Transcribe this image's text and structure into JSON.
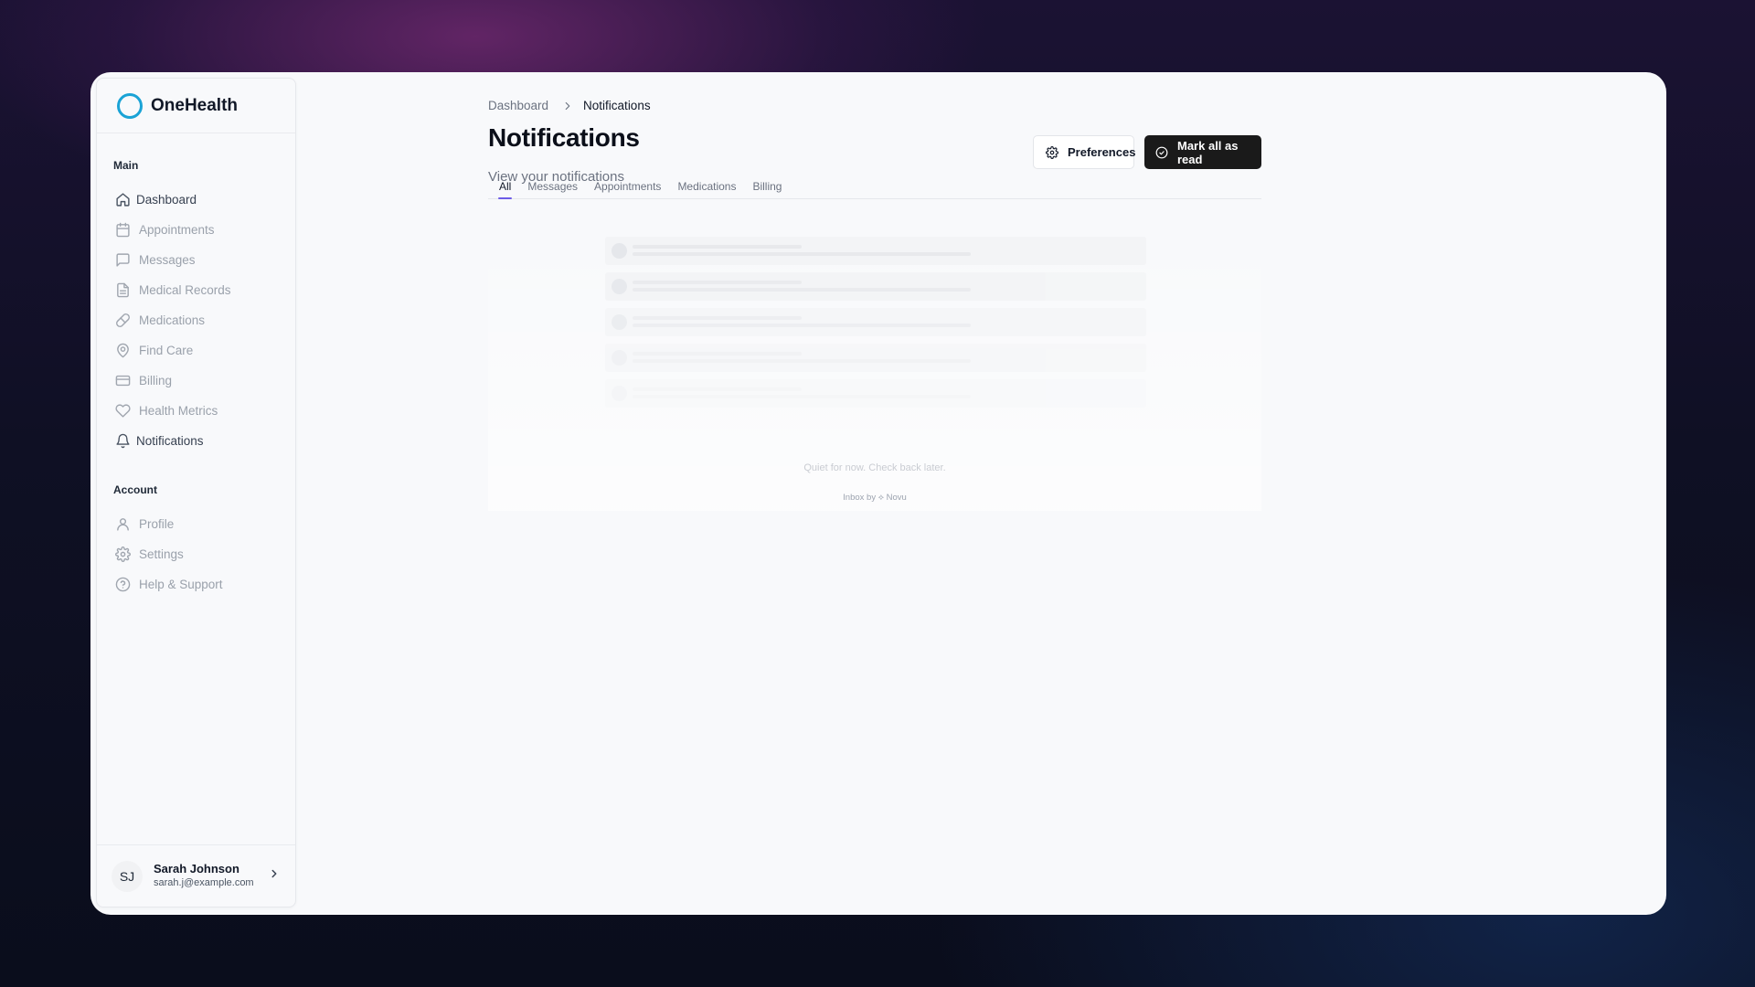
{
  "app": {
    "name": "OneHealth",
    "brand_color": "#1aa3d6"
  },
  "sidebar": {
    "main_title": "Main",
    "main_items": [
      {
        "label": "Dashboard",
        "icon": "home-icon"
      },
      {
        "label": "Appointments",
        "icon": "calendar-icon"
      },
      {
        "label": "Messages",
        "icon": "message-icon"
      },
      {
        "label": "Medical Records",
        "icon": "document-icon"
      },
      {
        "label": "Medications",
        "icon": "pill-icon"
      },
      {
        "label": "Find Care",
        "icon": "map-pin-icon"
      },
      {
        "label": "Billing",
        "icon": "credit-card-icon"
      },
      {
        "label": "Health Metrics",
        "icon": "heart-icon"
      },
      {
        "label": "Notifications",
        "icon": "bell-icon"
      }
    ],
    "account_title": "Account",
    "account_items": [
      {
        "label": "Profile",
        "icon": "user-icon"
      },
      {
        "label": "Settings",
        "icon": "gear-icon"
      },
      {
        "label": "Help & Support",
        "icon": "help-circle-icon"
      }
    ],
    "user": {
      "initials": "SJ",
      "name": "Sarah Johnson",
      "email": "sarah.j@example.com"
    }
  },
  "breadcrumb": {
    "parent": "Dashboard",
    "current": "Notifications"
  },
  "header": {
    "title": "Notifications",
    "subtitle": "View your notifications",
    "preferences_label": "Preferences",
    "mark_all_label": "Mark all as read"
  },
  "tabs": [
    {
      "label": "All",
      "active": true
    },
    {
      "label": "Messages",
      "active": false
    },
    {
      "label": "Appointments",
      "active": false
    },
    {
      "label": "Medications",
      "active": false
    },
    {
      "label": "Billing",
      "active": false
    }
  ],
  "inbox": {
    "empty_message": "Quiet for now. Check back later.",
    "powered_by": "Inbox by ⟡ Novu",
    "accent_color": "#6d5ce7"
  }
}
